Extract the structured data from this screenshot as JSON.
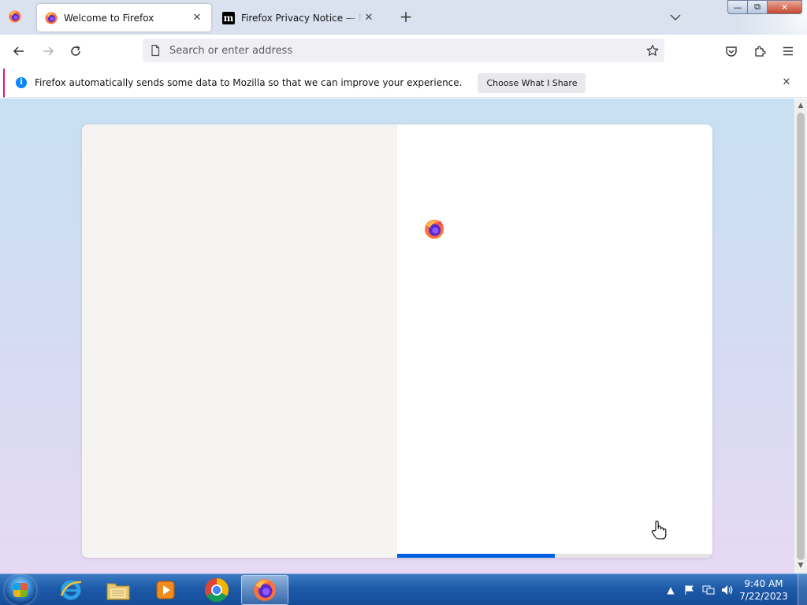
{
  "browser": {
    "tabs": [
      {
        "title": "Welcome to Firefox",
        "icon": "firefox-icon",
        "active": true
      },
      {
        "title": "Firefox Privacy Notice — Mozilla",
        "icon": "mozilla-m-icon",
        "active": false
      }
    ],
    "new_tab_icon": "plus-icon",
    "mozilla_m": "m",
    "window_controls": {
      "minimize": "—",
      "maximize": "⧉",
      "close": "✕"
    }
  },
  "navbar": {
    "url_placeholder": "Search or enter address",
    "url_value": ""
  },
  "notification": {
    "info_glyph": "i",
    "message": "Firefox automatically sends some data to Mozilla so that we can improve your experience.",
    "button_label": "Choose What I Share"
  },
  "welcome": {
    "progress_fraction": 0.5
  },
  "taskbar": {
    "apps": [
      "internet-explorer",
      "windows-explorer",
      "media-player",
      "chrome",
      "firefox"
    ],
    "active_app": "firefox",
    "clock_time": "9:40 AM",
    "clock_date": "7/22/2023"
  },
  "colors": {
    "accent_blue": "#0060df",
    "notification_stripe": "#e11586",
    "info_icon": "#0a84ff"
  }
}
